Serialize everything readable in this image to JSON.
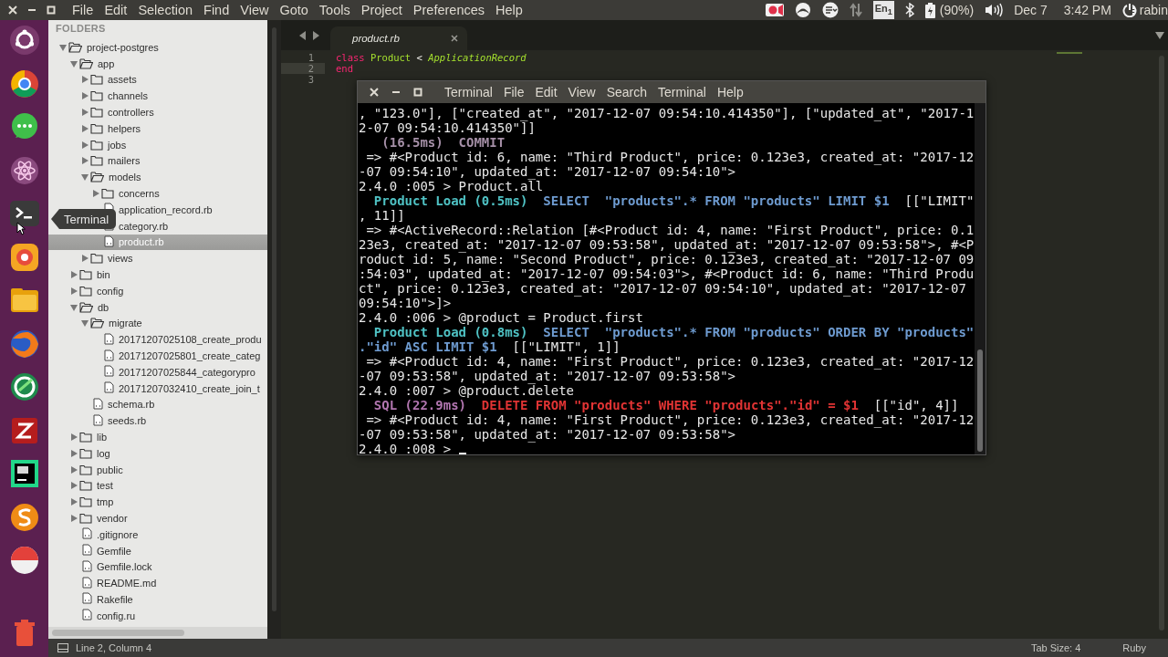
{
  "top_bar": {
    "menu": [
      "File",
      "Edit",
      "Selection",
      "Find",
      "View",
      "Goto",
      "Tools",
      "Project",
      "Preferences",
      "Help"
    ],
    "tray": {
      "keyboard": "En$_{1}$",
      "battery": "(90%)",
      "date": "Dec 7",
      "time": "3:42 PM",
      "user": "rabin"
    }
  },
  "launcher": {
    "tooltip": "Terminal"
  },
  "sidebar": {
    "header": "FOLDERS",
    "tree": [
      {
        "name": "project-postgres",
        "kind": "folder",
        "expanded": true,
        "selected": false,
        "children": [
          {
            "name": "app",
            "kind": "folder",
            "expanded": true,
            "selected": false,
            "children": [
              {
                "name": "assets",
                "kind": "folder",
                "expanded": false,
                "selected": false
              },
              {
                "name": "channels",
                "kind": "folder",
                "expanded": false,
                "selected": false
              },
              {
                "name": "controllers",
                "kind": "folder",
                "expanded": false,
                "selected": false
              },
              {
                "name": "helpers",
                "kind": "folder",
                "expanded": false,
                "selected": false
              },
              {
                "name": "jobs",
                "kind": "folder",
                "expanded": false,
                "selected": false
              },
              {
                "name": "mailers",
                "kind": "folder",
                "expanded": false,
                "selected": false
              },
              {
                "name": "models",
                "kind": "folder",
                "expanded": true,
                "selected": false,
                "children": [
                  {
                    "name": "concerns",
                    "kind": "folder",
                    "expanded": false,
                    "selected": false
                  },
                  {
                    "name": "application_record.rb",
                    "kind": "file",
                    "selected": false
                  },
                  {
                    "name": "category.rb",
                    "kind": "file",
                    "selected": false
                  },
                  {
                    "name": "product.rb",
                    "kind": "file",
                    "selected": true
                  }
                ]
              },
              {
                "name": "views",
                "kind": "folder",
                "expanded": false,
                "selected": false
              }
            ]
          },
          {
            "name": "bin",
            "kind": "folder",
            "expanded": false,
            "selected": false
          },
          {
            "name": "config",
            "kind": "folder",
            "expanded": false,
            "selected": false
          },
          {
            "name": "db",
            "kind": "folder",
            "expanded": true,
            "selected": false,
            "children": [
              {
                "name": "migrate",
                "kind": "folder",
                "expanded": true,
                "selected": false,
                "children": [
                  {
                    "name": "20171207025108_create_produ",
                    "kind": "file",
                    "selected": false
                  },
                  {
                    "name": "20171207025801_create_categ",
                    "kind": "file",
                    "selected": false
                  },
                  {
                    "name": "20171207025844_categorypro",
                    "kind": "file",
                    "selected": false
                  },
                  {
                    "name": "20171207032410_create_join_t",
                    "kind": "file",
                    "selected": false
                  }
                ]
              },
              {
                "name": "schema.rb",
                "kind": "file",
                "selected": false
              },
              {
                "name": "seeds.rb",
                "kind": "file",
                "selected": false
              }
            ]
          },
          {
            "name": "lib",
            "kind": "folder",
            "expanded": false,
            "selected": false
          },
          {
            "name": "log",
            "kind": "folder",
            "expanded": false,
            "selected": false
          },
          {
            "name": "public",
            "kind": "folder",
            "expanded": false,
            "selected": false
          },
          {
            "name": "test",
            "kind": "folder",
            "expanded": false,
            "selected": false
          },
          {
            "name": "tmp",
            "kind": "folder",
            "expanded": false,
            "selected": false
          },
          {
            "name": "vendor",
            "kind": "folder",
            "expanded": false,
            "selected": false
          },
          {
            "name": ".gitignore",
            "kind": "file",
            "selected": false
          },
          {
            "name": "Gemfile",
            "kind": "file",
            "selected": false
          },
          {
            "name": "Gemfile.lock",
            "kind": "file",
            "selected": false
          },
          {
            "name": "README.md",
            "kind": "file",
            "selected": false
          },
          {
            "name": "Rakefile",
            "kind": "file",
            "selected": false
          },
          {
            "name": "config.ru",
            "kind": "file",
            "selected": false
          }
        ]
      }
    ]
  },
  "editor": {
    "tab": "product.rb",
    "lines": [
      {
        "number": "1",
        "current": false,
        "segments": [
          {
            "kind": "keyword",
            "text": "class "
          },
          {
            "kind": "classname",
            "text": "Product"
          },
          {
            "kind": "plain",
            "text": " < "
          },
          {
            "kind": "parent",
            "text": "ApplicationRecord"
          }
        ]
      },
      {
        "number": "2",
        "current": true,
        "segments": [
          {
            "kind": "keyword",
            "text": "end"
          }
        ]
      },
      {
        "number": "3",
        "current": false
      }
    ]
  },
  "terminal": {
    "title": "Terminal",
    "menu": [
      "File",
      "Edit",
      "View",
      "Search",
      "Terminal",
      "Help"
    ],
    "lines": [
      {
        "segments": [
          {
            "kind": "plain",
            "text": ", \"123.0\"], [\"created_at\", \"2017-12-07 09:54:10.414350\"], [\"updated_at\", \"2017-1"
          }
        ]
      },
      {
        "segments": [
          {
            "kind": "plain",
            "text": "2-07 09:54:10.414350\"]]"
          }
        ]
      },
      {
        "segments": [
          {
            "kind": "dim",
            "text": "   (16.5ms)  COMMIT"
          }
        ]
      },
      {
        "segments": [
          {
            "kind": "plain",
            "text": " => #<Product id: 6, name: \"Third Product\", price: 0.123e3, created_at: \"2017-12"
          }
        ]
      },
      {
        "segments": [
          {
            "kind": "plain",
            "text": "-07 09:54:10\", updated_at: \"2017-12-07 09:54:10\">"
          }
        ]
      },
      {
        "segments": [
          {
            "kind": "plain",
            "text": "2.4.0 :005 > Product.all"
          }
        ]
      },
      {
        "segments": [
          {
            "kind": "load",
            "text": "  Product Load (0.5ms)"
          },
          {
            "kind": "query",
            "text": "  SELECT  \"products\".* FROM \"products\" LIMIT $1"
          },
          {
            "kind": "plain",
            "text": "  [[\"LIMIT\""
          }
        ]
      },
      {
        "segments": [
          {
            "kind": "plain",
            "text": ", 11]]"
          }
        ]
      },
      {
        "segments": [
          {
            "kind": "plain",
            "text": " => #<ActiveRecord::Relation [#<Product id: 4, name: \"First Product\", price: 0.1"
          }
        ]
      },
      {
        "segments": [
          {
            "kind": "plain",
            "text": "23e3, created_at: \"2017-12-07 09:53:58\", updated_at: \"2017-12-07 09:53:58\">, #<P"
          }
        ]
      },
      {
        "segments": [
          {
            "kind": "plain",
            "text": "roduct id: 5, name: \"Second Product\", price: 0.123e3, created_at: \"2017-12-07 09"
          }
        ]
      },
      {
        "segments": [
          {
            "kind": "plain",
            "text": ":54:03\", updated_at: \"2017-12-07 09:54:03\">, #<Product id: 6, name: \"Third Produ"
          }
        ]
      },
      {
        "segments": [
          {
            "kind": "plain",
            "text": "ct\", price: 0.123e3, created_at: \"2017-12-07 09:54:10\", updated_at: \"2017-12-07"
          }
        ]
      },
      {
        "segments": [
          {
            "kind": "plain",
            "text": "09:54:10\">]>"
          }
        ]
      },
      {
        "segments": [
          {
            "kind": "plain",
            "text": "2.4.0 :006 > @product = Product.first"
          }
        ]
      },
      {
        "segments": [
          {
            "kind": "load",
            "text": "  Product Load (0.8ms)"
          },
          {
            "kind": "query",
            "text": "  SELECT  \"products\".* FROM \"products\" ORDER BY \"products\""
          }
        ]
      },
      {
        "segments": [
          {
            "kind": "query",
            "text": ".\"id\" ASC LIMIT $1"
          },
          {
            "kind": "plain",
            "text": "  [[\"LIMIT\", 1]]"
          }
        ]
      },
      {
        "segments": [
          {
            "kind": "plain",
            "text": " => #<Product id: 4, name: \"First Product\", price: 0.123e3, created_at: \"2017-12"
          }
        ]
      },
      {
        "segments": [
          {
            "kind": "plain",
            "text": "-07 09:53:58\", updated_at: \"2017-12-07 09:53:58\">"
          }
        ]
      },
      {
        "segments": [
          {
            "kind": "plain",
            "text": "2.4.0 :007 > @product.delete"
          }
        ]
      },
      {
        "segments": [
          {
            "kind": "sql",
            "text": "  SQL (22.9ms)"
          },
          {
            "kind": "delete",
            "text": "  DELETE FROM \"products\" WHERE \"products\".\"id\" = $1"
          },
          {
            "kind": "plain",
            "text": "  [[\"id\", 4]]"
          }
        ]
      },
      {
        "segments": [
          {
            "kind": "plain",
            "text": " => #<Product id: 4, name: \"First Product\", price: 0.123e3, created_at: \"2017-12"
          }
        ]
      },
      {
        "segments": [
          {
            "kind": "plain",
            "text": "-07 09:53:58\", updated_at: \"2017-12-07 09:53:58\">"
          }
        ]
      },
      {
        "segments": [
          {
            "kind": "plain",
            "text": "2.4.0 :008 > "
          }
        ],
        "cursor": true
      }
    ]
  },
  "status_bar": {
    "position": "Line 2, Column 4",
    "tab_size": "Tab Size: 4",
    "syntax": "Ruby"
  }
}
